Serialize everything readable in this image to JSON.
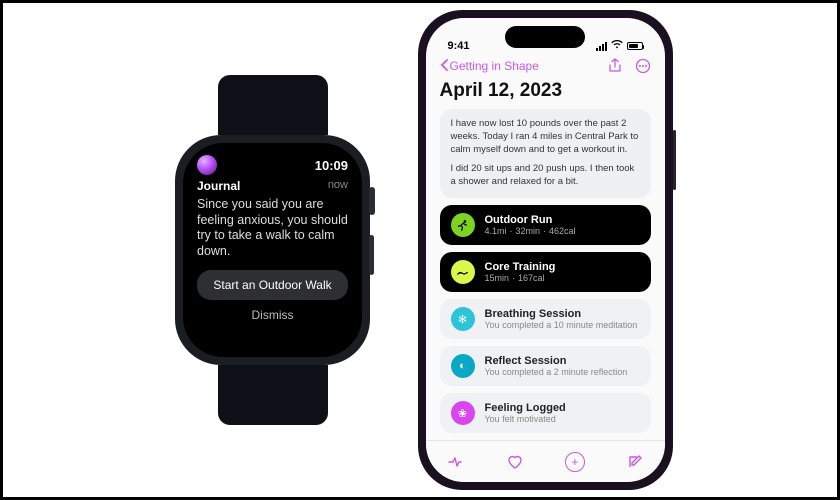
{
  "watch": {
    "time": "10:09",
    "app_name": "Journal",
    "timestamp": "now",
    "message": "Since you said you are feeling anxious, you should try to take a walk to calm down.",
    "primary_action": "Start an Outdoor Walk",
    "dismiss": "Dismiss"
  },
  "phone": {
    "status_time": "9:41",
    "nav_back_label": "Getting in Shape",
    "page_title": "April 12, 2023",
    "note_p1": "I have now lost 10 pounds over the past 2 weeks. Today I ran 4 miles in Central Park to calm myself down and to get a workout in.",
    "note_p2": "I did 20 sit ups and 20 push ups. I then took a shower and relaxed for a bit.",
    "workouts": [
      {
        "title": "Outdoor Run",
        "distance": "4.1mi",
        "duration": "32min",
        "calories": "462cal"
      },
      {
        "title": "Core Training",
        "duration": "15min",
        "calories": "167cal"
      }
    ],
    "sessions": [
      {
        "title": "Breathing Session",
        "sub": "You completed a 10 minute meditation"
      },
      {
        "title": "Reflect Session",
        "sub": "You completed a 2 minute reflection"
      },
      {
        "title": "Feeling Logged",
        "sub": "You felt motivated"
      }
    ]
  }
}
